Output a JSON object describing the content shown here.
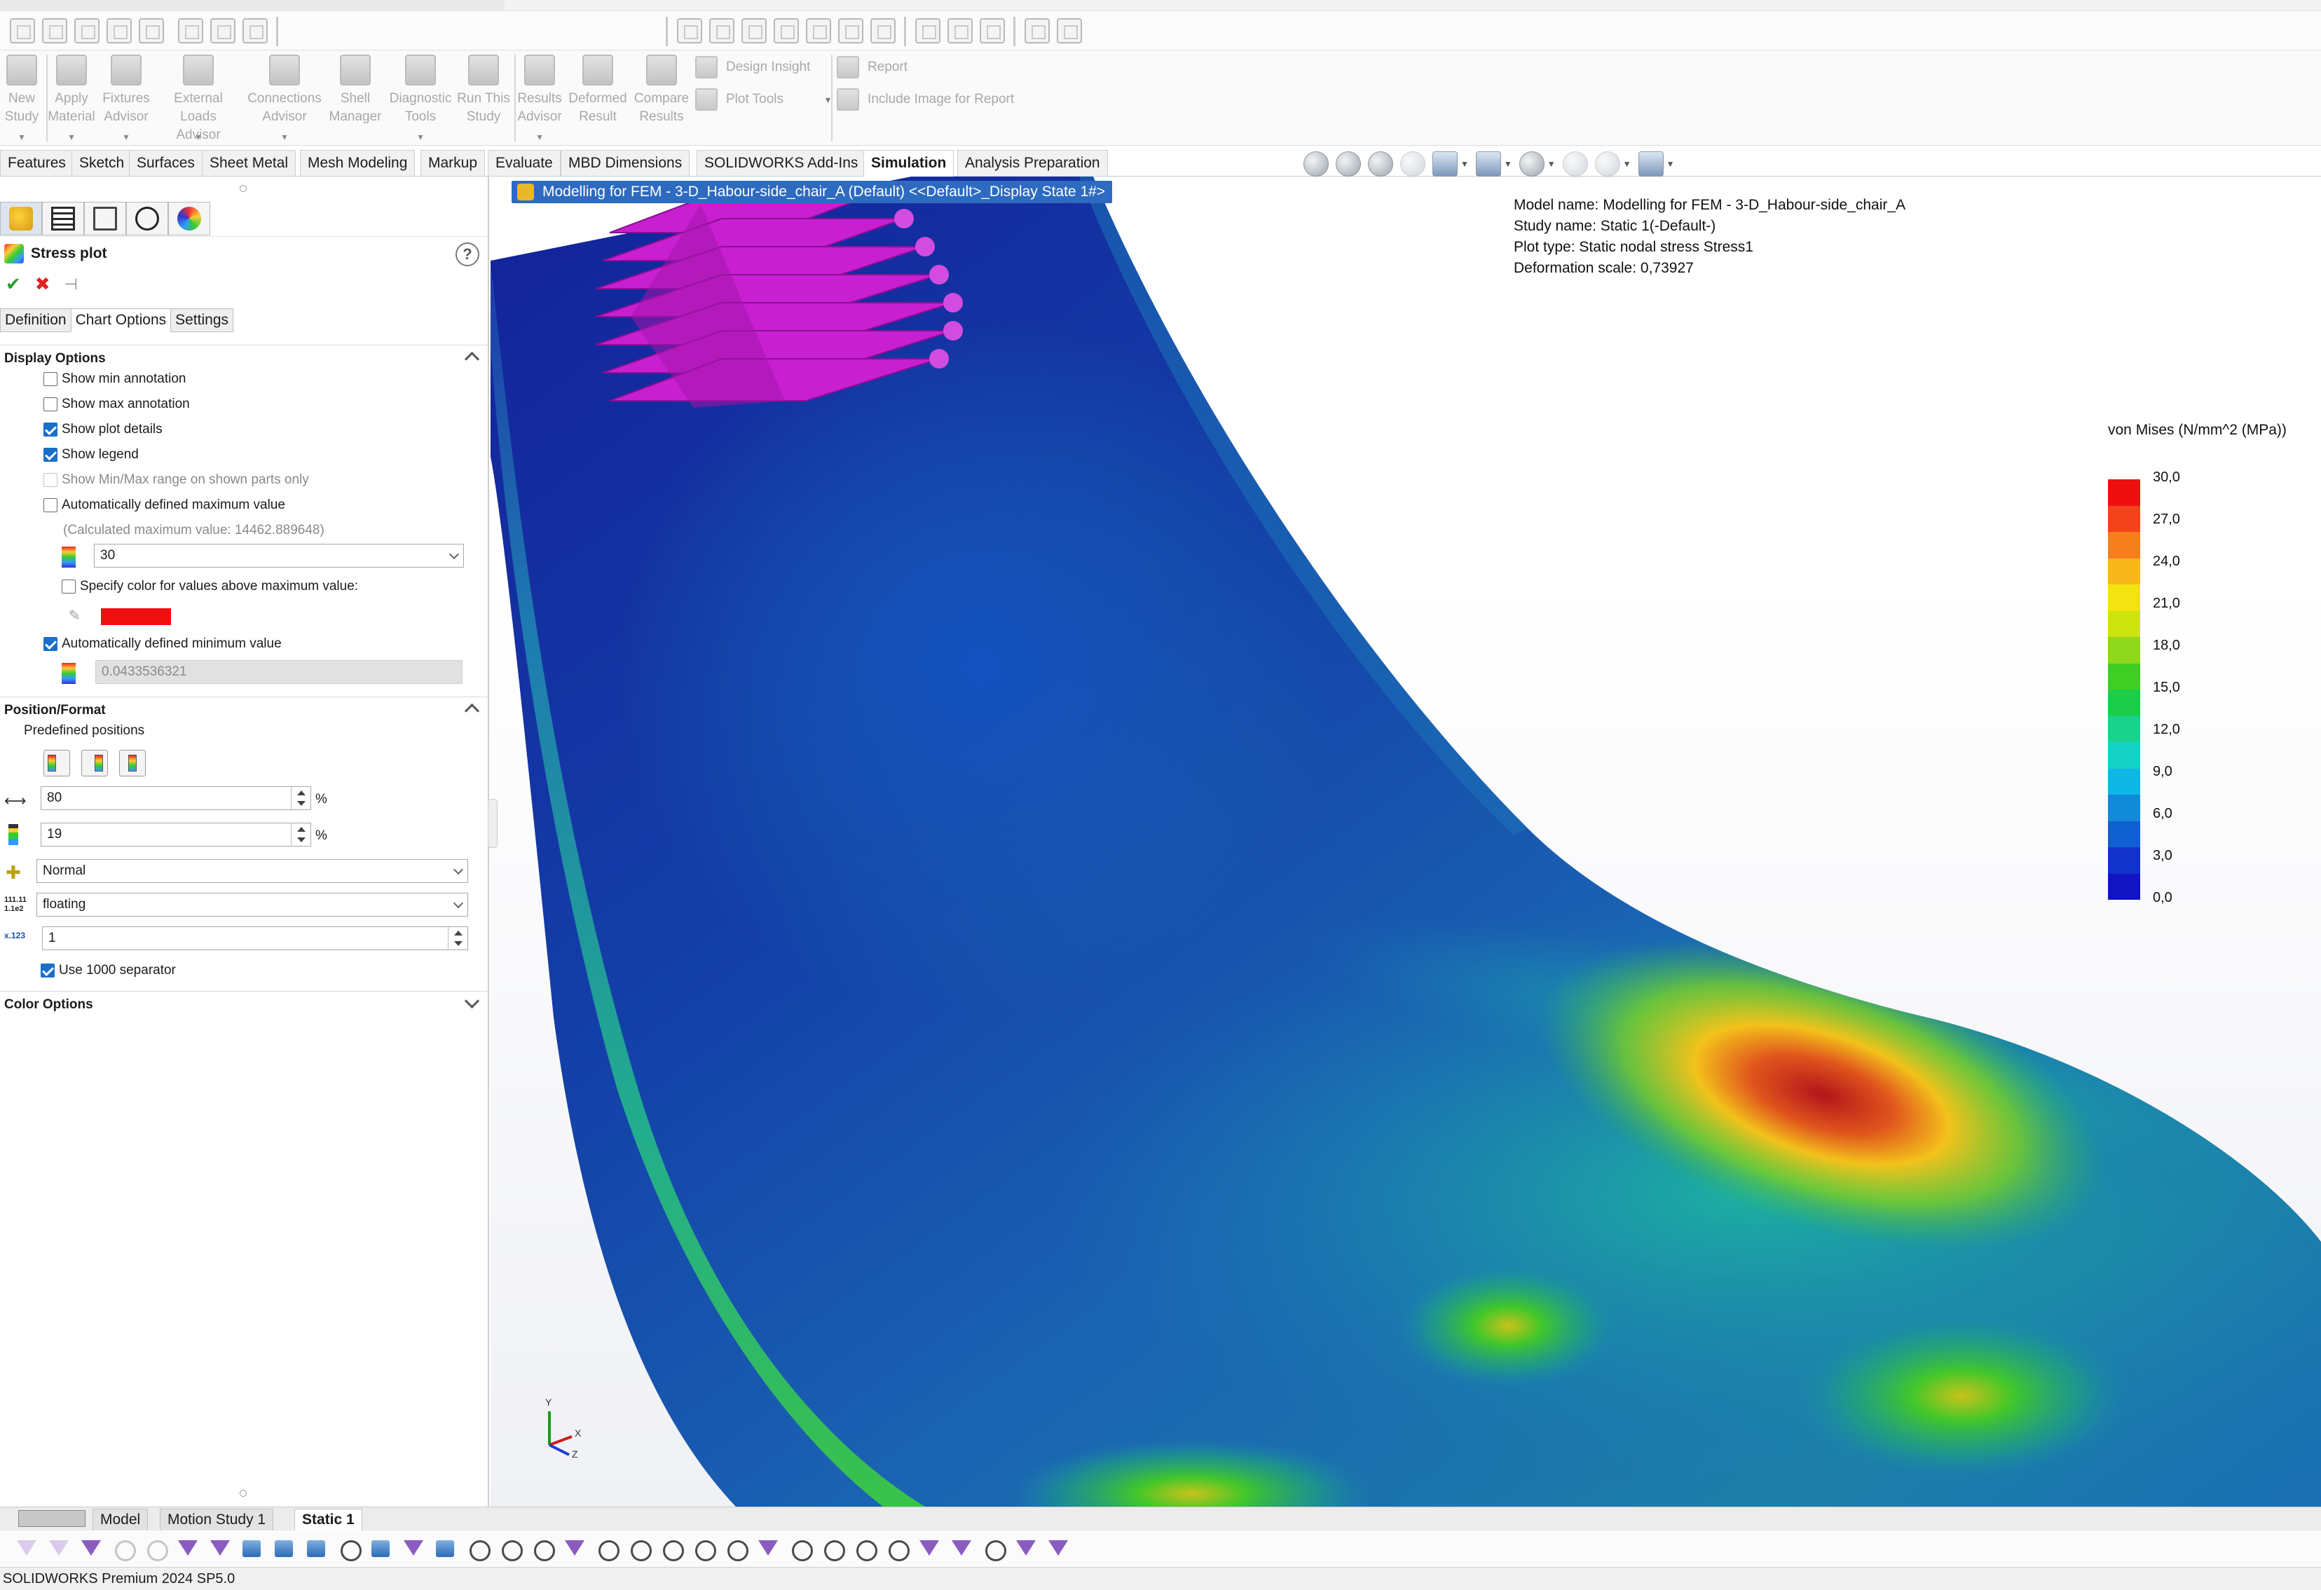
{
  "ribbon": {
    "buttons": [
      {
        "label": "New\nStudy",
        "icon": "new-study-icon"
      },
      {
        "label": "Apply\nMaterial",
        "icon": "apply-material-icon"
      },
      {
        "label": "Fixtures\nAdvisor",
        "icon": "fixtures-icon"
      },
      {
        "label": "External Loads\nAdvisor",
        "icon": "external-loads-icon"
      },
      {
        "label": "Connections\nAdvisor",
        "icon": "connections-icon"
      },
      {
        "label": "Shell\nManager",
        "icon": "shell-icon"
      },
      {
        "label": "Diagnostic\nTools",
        "icon": "diagnostic-icon"
      },
      {
        "label": "Run This\nStudy",
        "icon": "run-icon"
      },
      {
        "label": "Results\nAdvisor",
        "icon": "results-icon"
      },
      {
        "label": "Deformed\nResult",
        "icon": "deformed-icon"
      },
      {
        "label": "Compare\nResults",
        "icon": "compare-icon"
      }
    ],
    "small": {
      "design_insight": "Design Insight",
      "plot_tools": "Plot Tools",
      "report": "Report",
      "include_image": "Include Image for Report"
    }
  },
  "tabs": [
    "Features",
    "Sketch",
    "Surfaces",
    "Sheet Metal",
    "Mesh Modeling",
    "Markup",
    "Evaluate",
    "MBD Dimensions",
    "SOLIDWORKS Add-Ins",
    "Simulation",
    "Analysis Preparation"
  ],
  "active_tab": "Simulation",
  "pm": {
    "title": "Stress plot",
    "subtabs": [
      "Definition",
      "Chart Options",
      "Settings"
    ],
    "active_subtab": "Chart Options",
    "display_options": {
      "header": "Display Options",
      "show_min": "Show min annotation",
      "show_max": "Show max annotation",
      "show_plot_details": "Show plot details",
      "show_legend": "Show legend",
      "show_minmax_range": "Show Min/Max range on shown parts only",
      "auto_max": "Automatically defined maximum value",
      "calc_max": "(Calculated maximum value: 14462.889648)",
      "max_value": "30",
      "specify_color": "Specify color for values above maximum value:",
      "auto_min": "Automatically defined minimum value",
      "min_value": "0.0433536321"
    },
    "position_format": {
      "header": "Position/Format",
      "predefined": "Predefined positions",
      "x_pos": "80",
      "y_pos": "19",
      "pct": "%",
      "number_format": "Normal",
      "notation": "floating",
      "decimals": "1",
      "separator": "Use 1000 separator"
    },
    "color_options": {
      "header": "Color Options"
    }
  },
  "viewport": {
    "doc_tag": "Modelling for FEM - 3-D_Habour-side_chair_A (Default) <<Default>_Display State 1#>",
    "details": [
      "Model name: Modelling for FEM - 3-D_Habour-side_chair_A",
      "Study name: Static 1(-Default-)",
      "Plot type: Static nodal stress Stress1",
      "Deformation scale: 0,73927"
    ],
    "legend": {
      "title": "von Mises (N/mm^2 (MPa))",
      "labels": [
        "30,0",
        "27,0",
        "24,0",
        "21,0",
        "18,0",
        "15,0",
        "12,0",
        "9,0",
        "6,0",
        "3,0",
        "0,0"
      ],
      "colors": [
        "#ee1010",
        "#f3431a",
        "#f77e1c",
        "#f9b71c",
        "#f3e411",
        "#cde40e",
        "#8fd81d",
        "#3fcf22",
        "#1ccd49",
        "#19d28e",
        "#14d3c6",
        "#10b7e6",
        "#108ad9",
        "#1160d2",
        "#1233c9",
        "#1214c1"
      ]
    },
    "triad": {
      "y": "Y",
      "x": "X",
      "z": "Z"
    }
  },
  "bottom_tabs": [
    "Model",
    "Motion Study 1",
    "Static 1"
  ],
  "active_bottom_tab": "Static 1",
  "status": "SOLIDWORKS Premium 2024 SP5.0"
}
